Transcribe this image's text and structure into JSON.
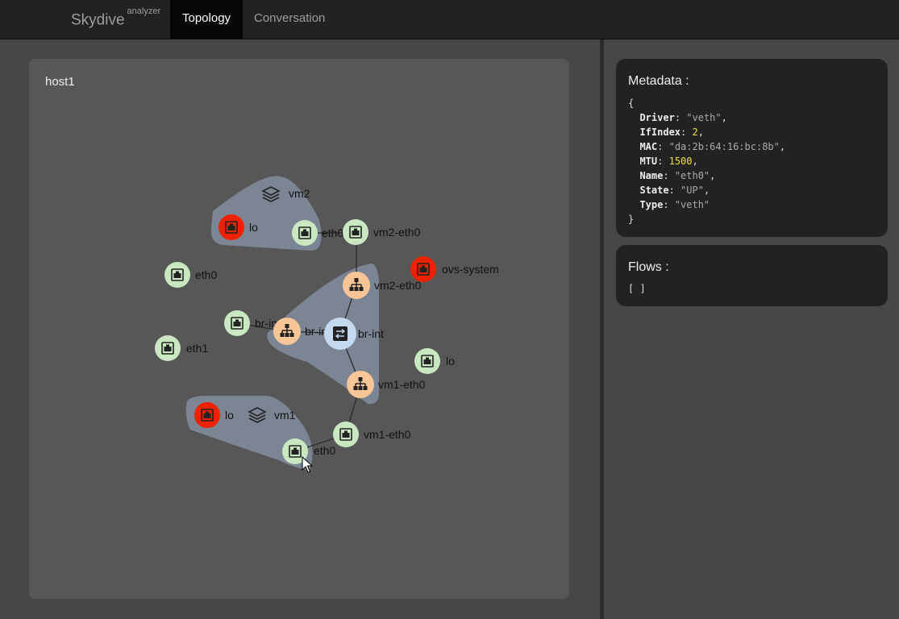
{
  "navbar": {
    "brand": "Skydive",
    "brand_sub": "analyzer",
    "tabs": [
      {
        "label": "Topology",
        "active": true
      },
      {
        "label": "Conversation",
        "active": false
      }
    ]
  },
  "topology": {
    "host": "host1",
    "groups": [
      {
        "label": "vm2",
        "icon": "layers-icon"
      },
      {
        "label": "vm1",
        "icon": "layers-icon"
      }
    ],
    "nodes": [
      {
        "id": "vm2-lo",
        "label": "lo",
        "type": "interface",
        "state": "down"
      },
      {
        "id": "vm2-eth0",
        "label": "eth0",
        "type": "interface",
        "state": "up"
      },
      {
        "id": "host-vm2-eth0",
        "label": "vm2-eth0",
        "type": "interface",
        "state": "up"
      },
      {
        "id": "ovs-system",
        "label": "ovs-system",
        "type": "interface",
        "state": "down"
      },
      {
        "id": "host-eth0",
        "label": "eth0",
        "type": "interface",
        "state": "up"
      },
      {
        "id": "port-vm2-eth0",
        "label": "vm2-eth0",
        "type": "ovsport"
      },
      {
        "id": "br-int-if",
        "label": "br-int",
        "type": "interface",
        "state": "up"
      },
      {
        "id": "br-int-port",
        "label": "br-int",
        "type": "ovsport"
      },
      {
        "id": "br-int-bridge",
        "label": "br-int",
        "type": "ovsbridge"
      },
      {
        "id": "host-eth1",
        "label": "eth1",
        "type": "interface",
        "state": "up"
      },
      {
        "id": "host-lo",
        "label": "lo",
        "type": "interface",
        "state": "up"
      },
      {
        "id": "port-vm1-eth0",
        "label": "vm1-eth0",
        "type": "ovsport"
      },
      {
        "id": "vm1-lo",
        "label": "lo",
        "type": "interface",
        "state": "down"
      },
      {
        "id": "host-vm1-eth0",
        "label": "vm1-eth0",
        "type": "interface",
        "state": "up"
      },
      {
        "id": "vm1-eth0",
        "label": "eth0",
        "type": "interface",
        "state": "up"
      }
    ],
    "colors": {
      "interface_up": "#c9e8c2",
      "interface_down": "#ee2200",
      "ovsport": "#f8c597",
      "ovsbridge": "#c4d8ee",
      "group_fill": "#7b8593",
      "canvas": "#575757"
    }
  },
  "metadata": {
    "title": "Metadata :",
    "open": "{",
    "close": "}",
    "fields": [
      {
        "key": "Driver",
        "value": "\"veth\"",
        "kind": "str",
        "comma": ","
      },
      {
        "key": "IfIndex",
        "value": "2",
        "kind": "num",
        "comma": ","
      },
      {
        "key": "MAC",
        "value": "\"da:2b:64:16:bc:8b\"",
        "kind": "str",
        "comma": ","
      },
      {
        "key": "MTU",
        "value": "1500",
        "kind": "num",
        "comma": ","
      },
      {
        "key": "Name",
        "value": "\"eth0\"",
        "kind": "str",
        "comma": ","
      },
      {
        "key": "State",
        "value": "\"UP\"",
        "kind": "str",
        "comma": ","
      },
      {
        "key": "Type",
        "value": "\"veth\"",
        "kind": "str",
        "comma": ""
      }
    ]
  },
  "flows": {
    "title": "Flows :",
    "value": "[ ]"
  }
}
